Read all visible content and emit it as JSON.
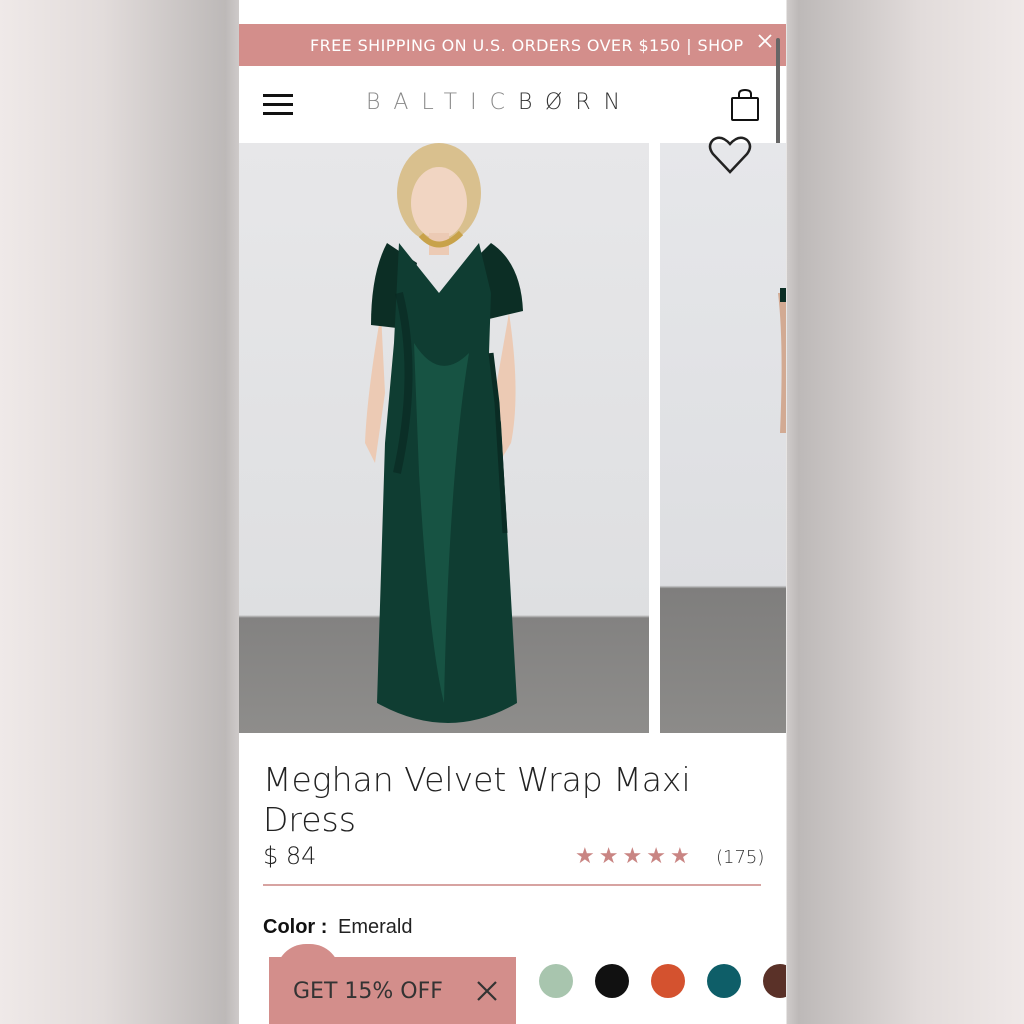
{
  "announcement": {
    "text": "FREE SHIPPING ON U.S. ORDERS OVER $150 | SHOP"
  },
  "header": {
    "logo_light": "BALTIC",
    "logo_dark": "BØRN"
  },
  "product": {
    "title": "Meghan Velvet Wrap Maxi Dress",
    "price": "$ 84",
    "rating": 5,
    "review_count": "(175)",
    "color_label": "Color :",
    "color_value": "Emerald",
    "accent_color": "#d38e8b",
    "star_color": "#c98583",
    "swatches": [
      {
        "name": "sage",
        "color": "#a8c5ae"
      },
      {
        "name": "black",
        "color": "#111111"
      },
      {
        "name": "rust",
        "color": "#d4522f"
      },
      {
        "name": "teal",
        "color": "#0e5e68"
      },
      {
        "name": "brown",
        "color": "#5a3128"
      }
    ]
  },
  "promo": {
    "text": "GET 15% OFF"
  },
  "icons": [
    "hamburger-icon",
    "shopping-bag-icon",
    "heart-icon",
    "close-icon",
    "star-icon"
  ]
}
